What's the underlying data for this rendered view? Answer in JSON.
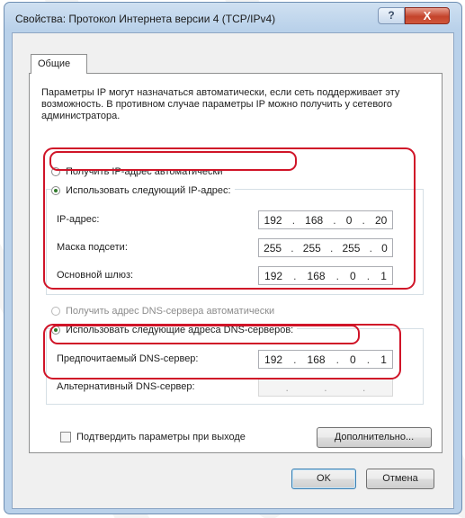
{
  "window": {
    "title": "Свойства: Протокол Интернета версии 4 (TCP/IPv4)",
    "help_glyph": "?",
    "close_glyph": "X"
  },
  "tabs": [
    {
      "label": "Общие"
    }
  ],
  "description": "Параметры IP могут назначаться автоматически, если сеть поддерживает эту возможность. В противном случае параметры IP можно получить у сетевого администратора.",
  "ip": {
    "auto_label": "Получить IP-адрес автоматически",
    "manual_label": "Использовать следующий IP-адрес:",
    "selected": "manual",
    "fields": [
      {
        "label": "IP-адрес:",
        "octets": [
          "192",
          "168",
          "0",
          "20"
        ]
      },
      {
        "label": "Маска подсети:",
        "octets": [
          "255",
          "255",
          "255",
          "0"
        ]
      },
      {
        "label": "Основной шлюз:",
        "octets": [
          "192",
          "168",
          "0",
          "1"
        ]
      }
    ]
  },
  "dns": {
    "auto_label": "Получить адрес DNS-сервера автоматически",
    "manual_label": "Использовать следующие адреса DNS-серверов:",
    "selected": "manual",
    "fields": [
      {
        "label": "Предпочитаемый DNS-сервер:",
        "octets": [
          "192",
          "168",
          "0",
          "1"
        ]
      },
      {
        "label": "Альтернативный DNS-сервер:",
        "octets": [
          "",
          "",
          "",
          ""
        ]
      }
    ]
  },
  "validate_label": "Подтвердить параметры при выходе",
  "validate_checked": false,
  "buttons": {
    "advanced": "Дополнительно...",
    "ok": "OK",
    "cancel": "Отмена"
  },
  "colors": {
    "highlight": "#d01428",
    "title_bar": "#b9d1ea"
  }
}
